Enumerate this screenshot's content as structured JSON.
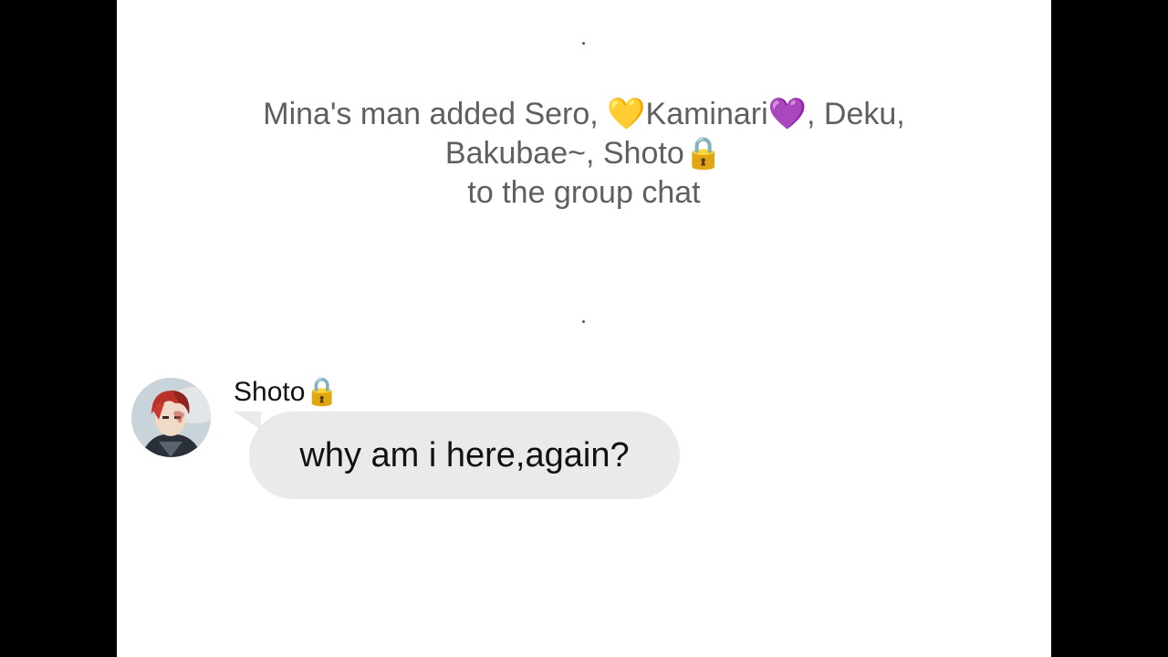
{
  "system_message": {
    "line1_prefix": "Mina's man added Sero, ",
    "heart1": "💛",
    "name_kaminari": "Kaminari",
    "heart2": "💜",
    "line1_suffix": ", Deku,",
    "line2_text": "Bakubae~, Shoto",
    "lock": "🔒",
    "line3": "to the group chat"
  },
  "message": {
    "sender": "Shoto",
    "sender_icon": "🔒",
    "text": "why am i here,again?",
    "avatar_icon": "avatar-shoto-icon"
  },
  "colors": {
    "background": "#ffffff",
    "bubble": "#eaeaea",
    "system_text": "#5f5f5f"
  }
}
